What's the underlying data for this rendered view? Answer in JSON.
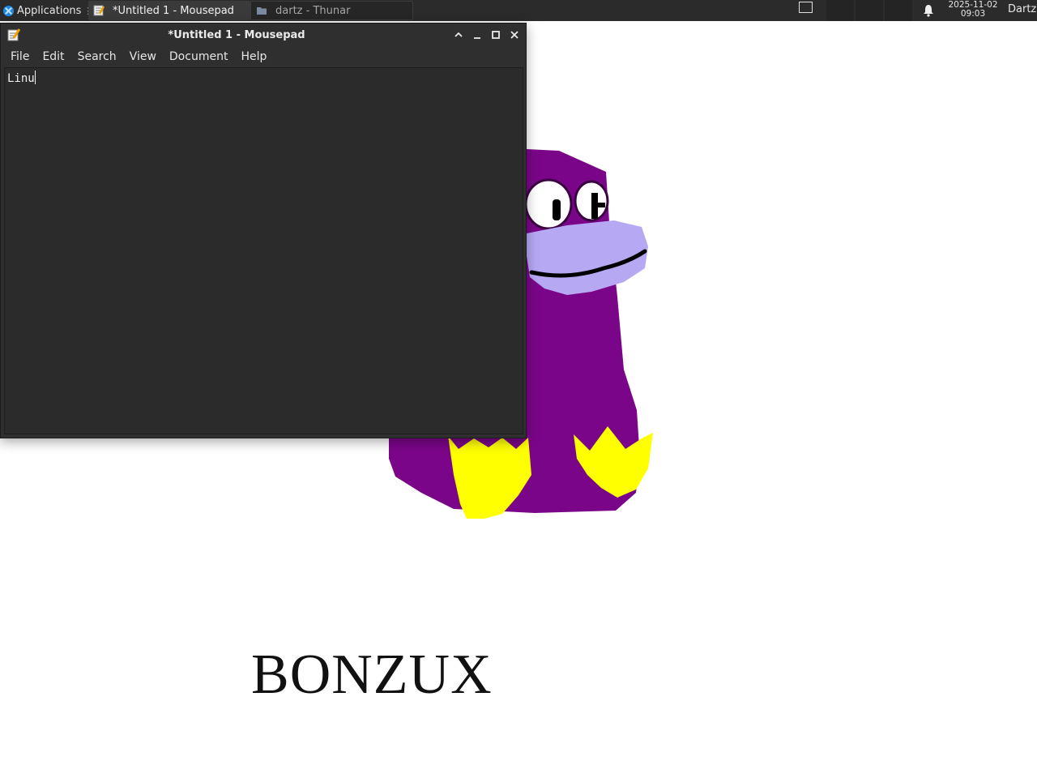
{
  "panel": {
    "applications_label": "Applications",
    "tasks": [
      {
        "label": "*Untitled 1 - Mousepad",
        "icon": "text-editor-icon",
        "active": true
      },
      {
        "label": "dartz - Thunar",
        "icon": "folder-icon",
        "active": false
      }
    ],
    "clock_date": "2025-11-02",
    "clock_time": "09:03",
    "user": "Dartz"
  },
  "window": {
    "title": "*Untitled 1 - Mousepad",
    "menu": [
      "File",
      "Edit",
      "Search",
      "View",
      "Document",
      "Help"
    ],
    "editor_text": "Linu"
  },
  "wallpaper": {
    "wordmark": "BONZUX",
    "colors": {
      "body": "#7b0589",
      "beak": "#b7a8f4",
      "feet": "#ffff00",
      "eye": "#ffffff",
      "pupil": "#000000"
    }
  },
  "colors": {
    "panel": "#2b2b2b",
    "window": "#2f2f2f",
    "editor": "#2b2b2b",
    "desktop": "#ffffff"
  }
}
